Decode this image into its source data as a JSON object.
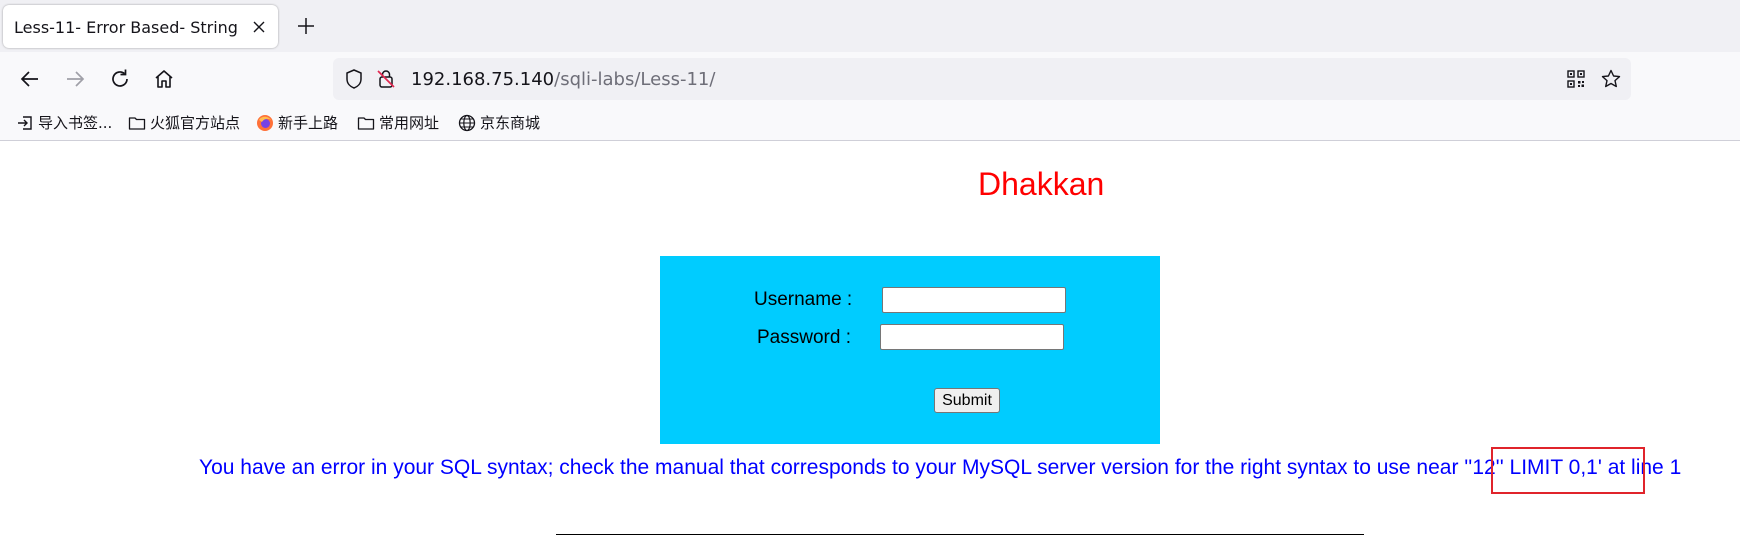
{
  "tab": {
    "title": "Less-11- Error Based- String"
  },
  "navigation": {
    "url_host": "192.168.75.140",
    "url_path": "/sqli-labs/Less-11/"
  },
  "bookmarks": [
    {
      "label": "导入书签...",
      "icon": "import-icon"
    },
    {
      "label": "火狐官方站点",
      "icon": "folder-icon"
    },
    {
      "label": "新手上路",
      "icon": "firefox-icon"
    },
    {
      "label": "常用网址",
      "icon": "folder-icon"
    },
    {
      "label": "京东商城",
      "icon": "globe-icon"
    }
  ],
  "page": {
    "title": "Dhakkan",
    "username_label": "Username :",
    "password_label": "Password :",
    "username_value": "",
    "password_value": "",
    "submit_label": "Submit",
    "error_message": "You have an error in your SQL syntax; check the manual that corresponds to your MySQL server version for the right syntax to use near ''12'' LIMIT 0,1' at line 1"
  },
  "colors": {
    "title": "#ff0000",
    "login_box": "#00ccff",
    "error_text": "#0000ff",
    "highlight_box": "#e0242b"
  }
}
